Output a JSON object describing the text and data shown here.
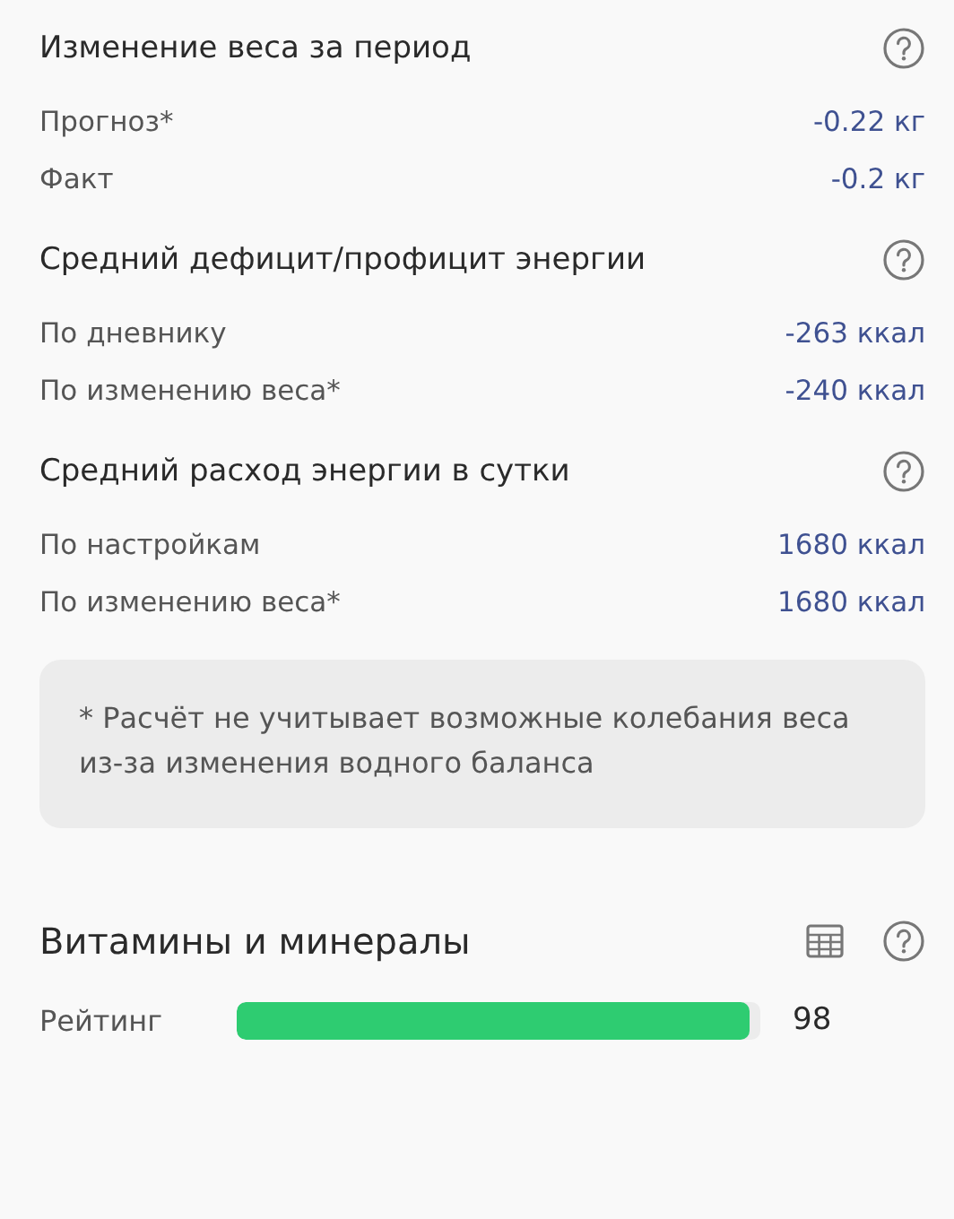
{
  "sections": [
    {
      "title": "Изменение веса за период",
      "rows": [
        {
          "label": "Прогноз*",
          "value": "-0.22 кг"
        },
        {
          "label": "Факт",
          "value": "-0.2 кг"
        }
      ]
    },
    {
      "title": "Средний дефицит/профицит энергии",
      "rows": [
        {
          "label": "По дневнику",
          "value": "-263 ккал"
        },
        {
          "label": "По изменению веса*",
          "value": "-240 ккал"
        }
      ]
    },
    {
      "title": "Средний расход энергии в сутки",
      "rows": [
        {
          "label": "По настройкам",
          "value": "1680 ккал"
        },
        {
          "label": "По изменению веса*",
          "value": "1680 ккал"
        }
      ]
    }
  ],
  "note": "* Расчёт не учитывает возможные колебания веса из-за изменения водного баланса",
  "vitamins": {
    "title": "Витамины и минералы",
    "rating": {
      "label": "Рейтинг",
      "level": 0.98,
      "value": "98"
    }
  }
}
